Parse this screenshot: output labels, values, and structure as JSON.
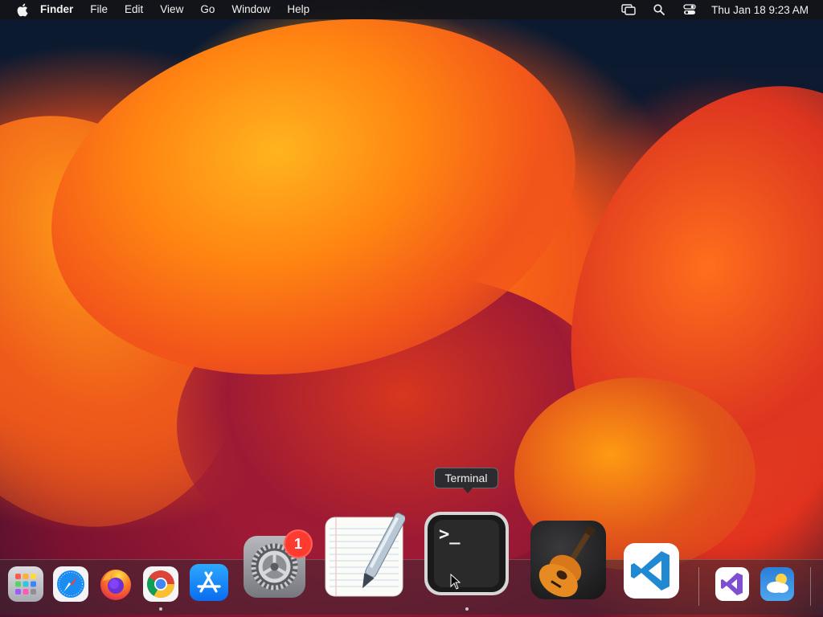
{
  "menubar": {
    "app_name": "Finder",
    "menus": [
      "File",
      "Edit",
      "View",
      "Go",
      "Window",
      "Help"
    ],
    "clock": "Thu Jan 18  9:23 AM",
    "status_icons": [
      "screen-mirroring-icon",
      "spotlight-search-icon",
      "control-center-icon"
    ]
  },
  "tooltip": {
    "text": "Terminal"
  },
  "dock": {
    "apps": [
      {
        "name": "Launchpad",
        "icon": "launchpad-icon",
        "running": false
      },
      {
        "name": "Safari",
        "icon": "safari-icon",
        "running": false
      },
      {
        "name": "Firefox",
        "icon": "firefox-icon",
        "running": false
      },
      {
        "name": "Google Chrome",
        "icon": "chrome-icon",
        "running": true
      },
      {
        "name": "App Store",
        "icon": "app-store-icon",
        "running": false
      },
      {
        "name": "System Settings",
        "icon": "system-settings-icon",
        "running": false,
        "badge": "1"
      },
      {
        "name": "TextEdit",
        "icon": "textedit-icon",
        "running": false
      },
      {
        "name": "Terminal",
        "icon": "terminal-icon",
        "running": true,
        "hovered": true
      },
      {
        "name": "GarageBand",
        "icon": "garageband-icon",
        "running": false
      },
      {
        "name": "Visual Studio Code",
        "icon": "vscode-icon",
        "running": false
      },
      {
        "name": "Visual Studio",
        "icon": "visual-studio-icon",
        "running": false
      },
      {
        "name": "Weather",
        "icon": "weather-icon",
        "running": false
      }
    ],
    "terminal_prompt": ">_"
  },
  "colors": {
    "badge": "#ff3b30",
    "menubar_bg": "#141418",
    "vscode_blue": "#1f8ad2",
    "app_store_blue": "#1a8cf0"
  }
}
